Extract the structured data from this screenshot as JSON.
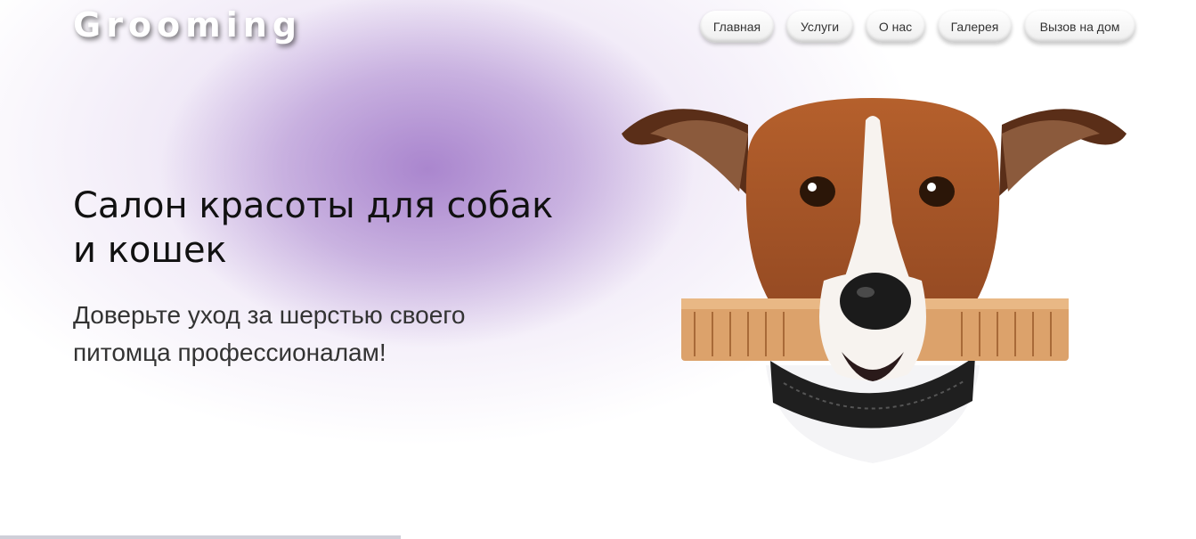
{
  "header": {
    "logo": "Grooming",
    "nav": [
      "Главная",
      "Услуги",
      "О нас",
      "Галерея",
      "Вызов на дом"
    ]
  },
  "hero": {
    "title_line1": "Салон красоты для собак",
    "title_line2": "и кошек",
    "subtitle_line1": "Доверьте уход за шерстью своего",
    "subtitle_line2": "питомца профессионалам!"
  },
  "image": {
    "icon": "dog-with-comb-photo"
  },
  "colors": {
    "accent_glow": "#a07ac8",
    "text": "#111111",
    "nav_bg": "#f2f2f2"
  }
}
